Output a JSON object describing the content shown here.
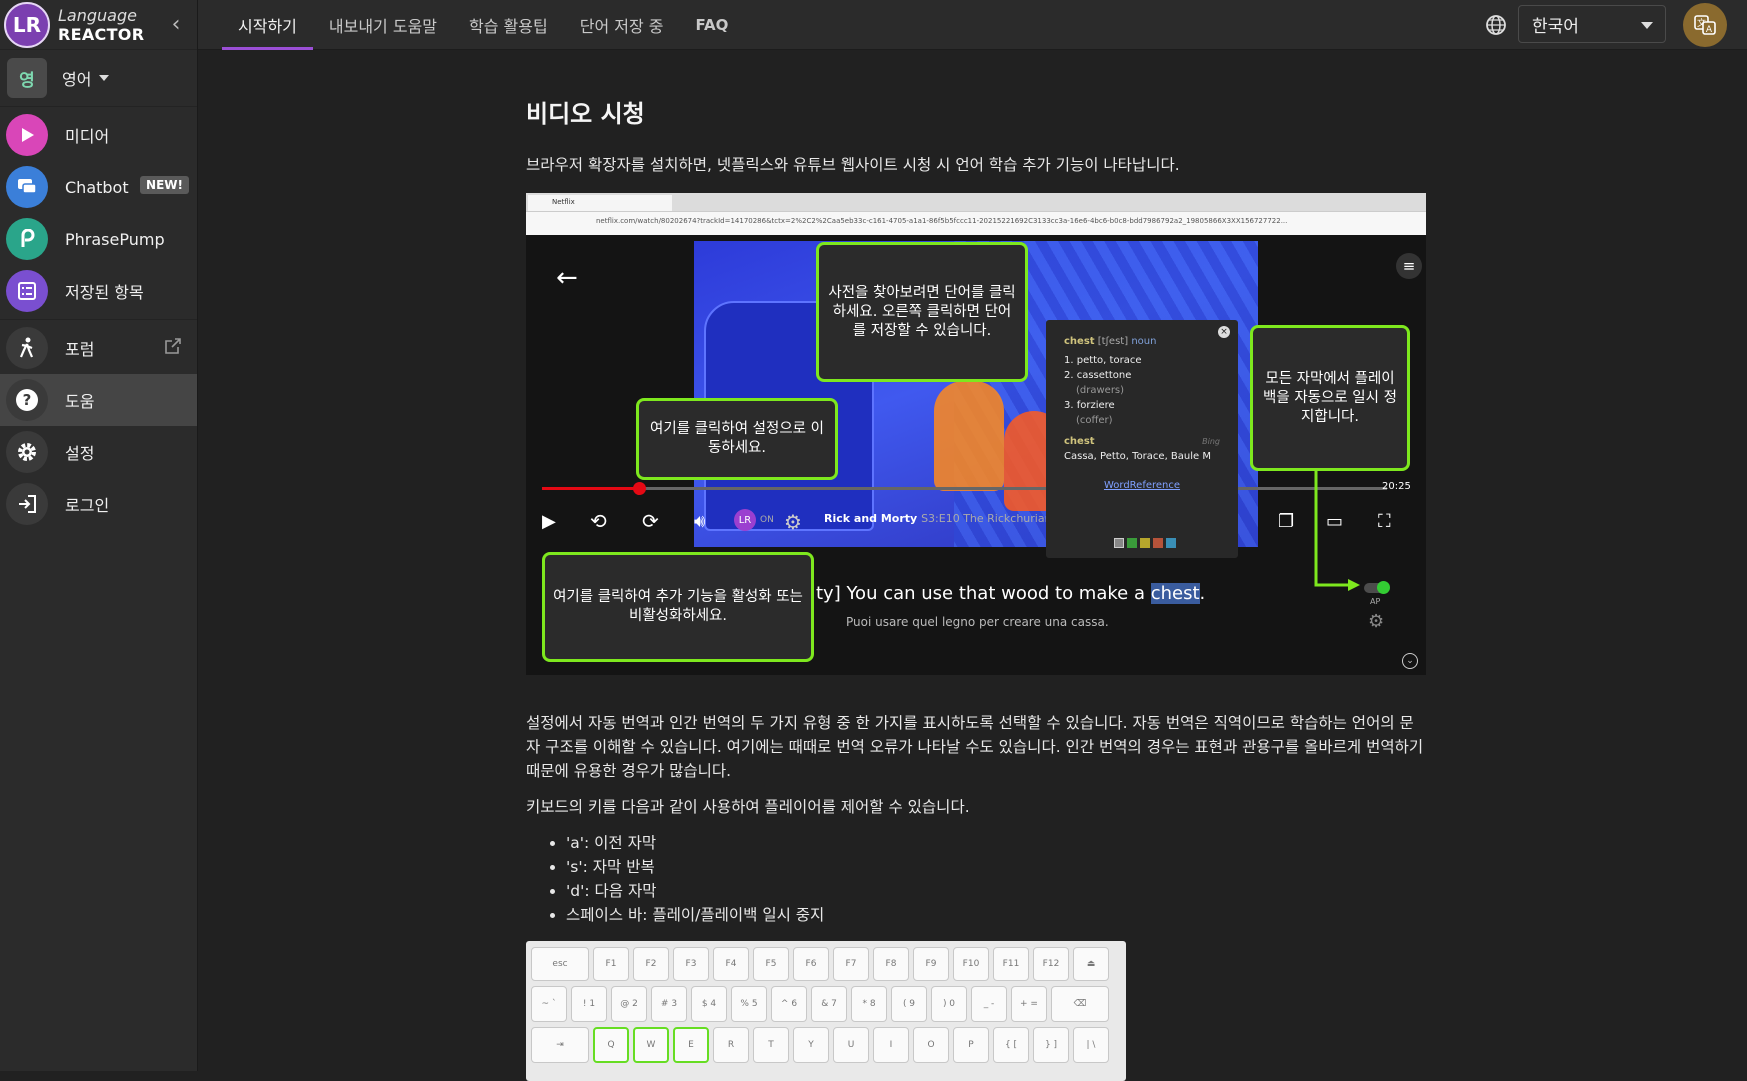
{
  "brand": {
    "line1": "Language",
    "line2": "REACTOR",
    "logo_glyph": "LR"
  },
  "sidebar": {
    "language_badge": "영",
    "language_label": "영어",
    "items": [
      {
        "label": "미디어",
        "icon": "play-icon",
        "color": "#d946b8"
      },
      {
        "label": "Chatbot",
        "badge": "NEW!",
        "icon": "chat-icon",
        "color": "#3b7fd9"
      },
      {
        "label": "PhrasePump",
        "icon": "phrasepump-icon",
        "color": "#2aa58a"
      },
      {
        "label": "저장된 항목",
        "icon": "list-icon",
        "color": "#7a4fd0"
      },
      {
        "label": "포럼",
        "icon": "walk-icon",
        "color": "#3a3a3a"
      },
      {
        "label": "도움",
        "icon": "help-icon",
        "color": "#3a3a3a"
      },
      {
        "label": "설정",
        "icon": "gear-icon",
        "color": "#3a3a3a"
      },
      {
        "label": "로그인",
        "icon": "login-icon",
        "color": "#3a3a3a"
      }
    ]
  },
  "topbar": {
    "tabs": [
      "시작하기",
      "내보내기 도움말",
      "학습 활용팁",
      "단어 저장 중",
      "FAQ"
    ],
    "ui_language": "한국어"
  },
  "main": {
    "heading": "비디오 시청",
    "intro": "브라우저 확장자를 설치하면, 넷플릭스와 유튜브 웹사이트 시청 시 언어 학습 추가 기능이 나타납니다.",
    "video": {
      "browser_tab": "Netflix",
      "url": "netflix.com/watch/80202674?trackId=14170286&tctx=2%2C2%2Caa5eb33c-c161-4705-a1a1-86f5b5fccc11-20215221692C3133cc3a-16e6-4bc6-b0c8-bdd7986792a2_19805866X3XX156727722...",
      "time": "20:25",
      "show": "Rick and Morty",
      "episode": "S3:E10  The Rickchurian M",
      "ext_on": "ON",
      "dict": {
        "headword": "chest",
        "pron": "[tʃest]",
        "pos": "noun",
        "senses": [
          "1. petto, torace",
          "2. cassettone",
          "(drawers)",
          "3. forziere",
          "(coffer)"
        ],
        "word2": "chest",
        "source": "Bing",
        "translations": "Cassa, Petto, Torace, Baule M",
        "link": "WordReference"
      },
      "subtitle_pre": "ty] You can use that wood to make a ",
      "subtitle_hl": "chest",
      "subtitle_post": ".",
      "subtitle_translation": "Puoi usare quel legno per creare una cassa.",
      "ap": "AP",
      "callouts": {
        "dictionary": "사전을 찾아보려면 단어를 클릭하세요. 오른쪽 클릭하면 단어를 저장할 수 있습니다.",
        "settings": "여기를 클릭하여 설정으로 이동하세요.",
        "autopause": "모든 자막에서 플레이백을 자동으로 일시 정지합니다.",
        "toggle": "여기를 클릭하여 추가 기능을 활성화 또는 비활성화하세요."
      }
    },
    "para_translation": "설정에서 자동 번역과 인간 번역의 두 가지 유형 중 한 가지를 표시하도록 선택할 수 있습니다. 자동 번역은 직역이므로 학습하는 언어의 문자 구조를 이해할 수 있습니다. 여기에는 때때로 번역 오류가 나타날 수도 있습니다. 인간 번역의 경우는 표현과 관용구를 올바르게 번역하기 때문에 유용한 경우가 많습니다.",
    "para_keys": "키보드의 키를 다음과 같이 사용하여 플레이어를 제어할 수 있습니다.",
    "shortcuts": [
      "'a': 이전 자막",
      "'s': 자막 반복",
      "'d': 다음 자막",
      "스페이스 바: 플레이/플레이백 일시 중지"
    ],
    "keyboard": {
      "row1": [
        "esc",
        "F1",
        "F2",
        "F3",
        "F4",
        "F5",
        "F6",
        "F7",
        "F8",
        "F9",
        "F10",
        "F11",
        "F12",
        "⏏"
      ],
      "row2": [
        "~ `",
        "! 1",
        "@ 2",
        "# 3",
        "$ 4",
        "% 5",
        "^ 6",
        "& 7",
        "* 8",
        "( 9",
        ") 0",
        "_ -",
        "+ =",
        "⌫"
      ],
      "row3": [
        "⇥",
        "Q",
        "W",
        "E",
        "R",
        "T",
        "Y",
        "U",
        "I",
        "O",
        "P",
        "{ [",
        "} ]",
        "| \\"
      ]
    }
  }
}
